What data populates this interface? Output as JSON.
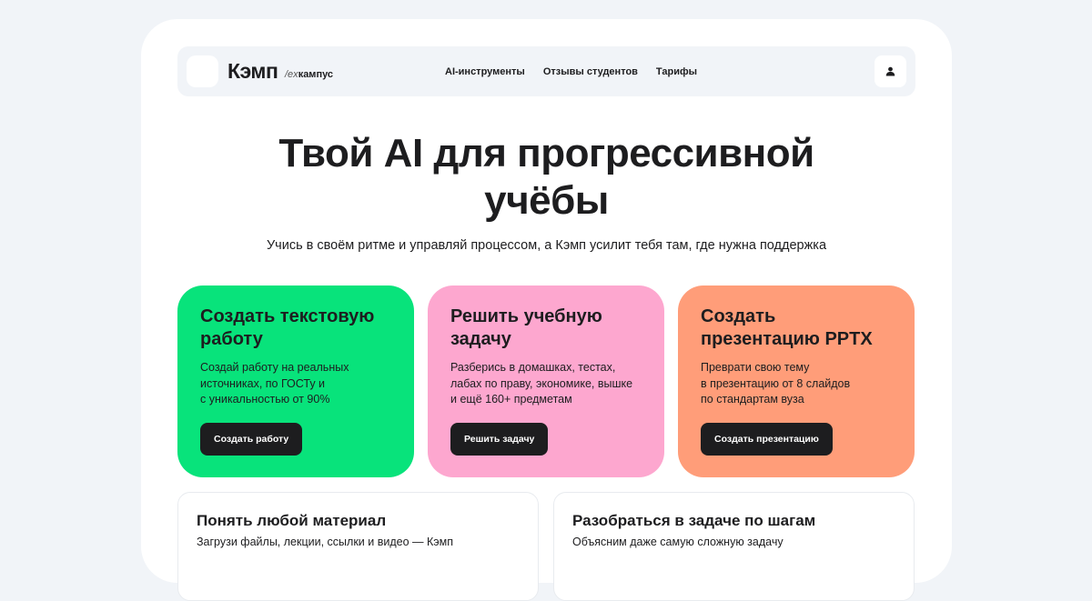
{
  "header": {
    "brand": "Кэмп",
    "brand_prefix": "/ex",
    "brand_sub": "кампус",
    "nav": [
      "AI-инструменты",
      "Отзывы студентов",
      "Тарифы"
    ],
    "user_icon": "user-icon"
  },
  "hero": {
    "title_line1": "Твой AI для прогрессивной",
    "title_line2": "учёбы",
    "subtitle": "Учись в своём ритме и управляй процессом, а Кэмп усилит тебя там, где нужна поддержка"
  },
  "cards": [
    {
      "title_line1": "Создать текстовую",
      "title_line2": "работу",
      "desc_lines": [
        "Создай работу на реальных",
        "источниках, по ГОСТу и",
        "с уникальностью от 90%"
      ],
      "button": "Создать работу",
      "color": "#08e37b"
    },
    {
      "title_line1": "Решить учебную",
      "title_line2": "задачу",
      "desc_lines": [
        "Разберись в домашках, тестах,",
        "лабах по праву, экономике, вышке",
        "и ещё 160+ предметам"
      ],
      "button": "Решить задачу",
      "color": "#fda7cf"
    },
    {
      "title_line1": "Создать",
      "title_line2": "презентацию PPTX",
      "desc_lines": [
        "Преврати свою тему",
        "в презентацию от 8 слайдов",
        "по стандартам вуза"
      ],
      "button": "Создать презентацию",
      "color": "#ff9d79"
    }
  ],
  "features": [
    {
      "title": "Понять любой материал",
      "desc": "Загрузи файлы, лекции, ссылки и видео — Кэмп"
    },
    {
      "title": "Разобраться в задаче по шагам",
      "desc": "Объясним даже самую сложную задачу"
    }
  ]
}
